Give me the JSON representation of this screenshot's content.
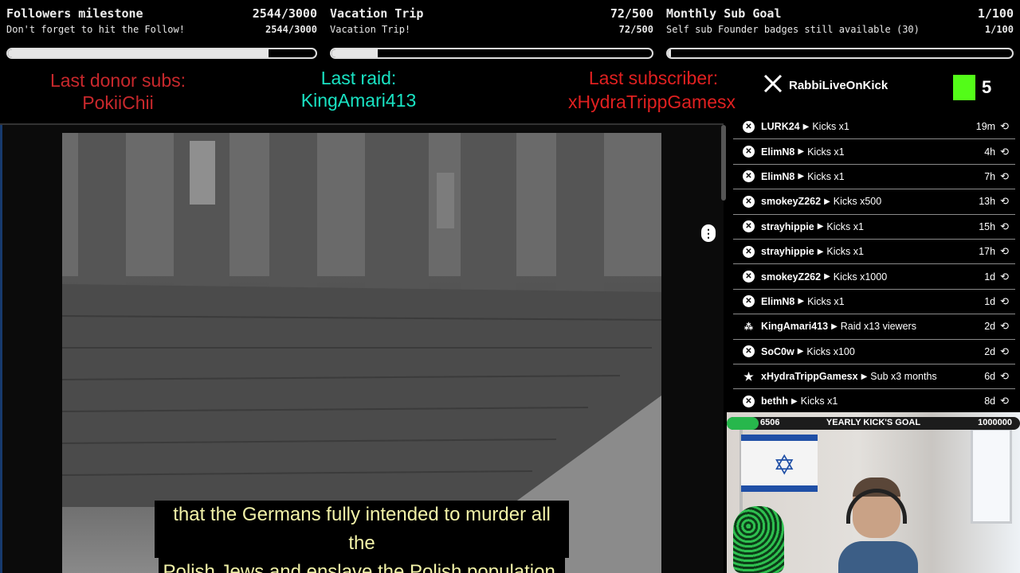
{
  "goals": [
    {
      "title": "Followers milestone",
      "count": "2544/3000",
      "subtitle": "Don't forget to hit the Follow!",
      "subcount": "2544/3000",
      "progress": 0.848
    },
    {
      "title": "Vacation Trip",
      "count": "72/500",
      "subtitle": "Vacation Trip!",
      "subcount": "72/500",
      "progress": 0.144
    },
    {
      "title": "Monthly Sub Goal",
      "count": "1/100",
      "subtitle": "Self sub Founder badges still available (30)",
      "subcount": "1/100",
      "progress": 0.01
    }
  ],
  "banner": {
    "last_donor_label": "Last donor subs:",
    "last_donor_name": "PokiiChii",
    "last_raid_label": "Last raid:",
    "last_raid_name": "KingAmari413",
    "last_sub_label": "Last subscriber:",
    "last_sub_name": "xHydraTrippGamesx",
    "x_handle": "RabbiLiveOnKick",
    "kick_count": "5"
  },
  "video": {
    "caption_line1": "that the Germans fully intended to murder all the",
    "caption_line2": "Polish Jews and enslave the Polish population,"
  },
  "events": [
    {
      "name": "LURK24",
      "action": "Kicks x1",
      "time": "19m",
      "icon": "kick-icon"
    },
    {
      "name": "ElimN8",
      "action": "Kicks x1",
      "time": "4h",
      "icon": "kick-icon"
    },
    {
      "name": "ElimN8",
      "action": "Kicks x1",
      "time": "7h",
      "icon": "kick-icon"
    },
    {
      "name": "smokeyZ262",
      "action": "Kicks x500",
      "time": "13h",
      "icon": "kick-icon"
    },
    {
      "name": "strayhippie",
      "action": "Kicks x1",
      "time": "15h",
      "icon": "kick-icon"
    },
    {
      "name": "strayhippie",
      "action": "Kicks x1",
      "time": "17h",
      "icon": "kick-icon"
    },
    {
      "name": "smokeyZ262",
      "action": "Kicks x1000",
      "time": "1d",
      "icon": "kick-icon"
    },
    {
      "name": "ElimN8",
      "action": "Kicks x1",
      "time": "1d",
      "icon": "kick-icon"
    },
    {
      "name": "KingAmari413",
      "action": "Raid x13 viewers",
      "time": "2d",
      "icon": "raid-icon"
    },
    {
      "name": "SoC0w",
      "action": "Kicks x100",
      "time": "2d",
      "icon": "kick-icon"
    },
    {
      "name": "xHydraTrippGamesx",
      "action": "Sub x3 months",
      "time": "6d",
      "icon": "star-icon"
    },
    {
      "name": "bethh",
      "action": "Kicks x1",
      "time": "8d",
      "icon": "kick-icon"
    }
  ],
  "yearly_goal": {
    "current": "6506",
    "title": "YEARLY KICK'S GOAL",
    "max": "1000000",
    "progress": 0.0065
  },
  "colors": {
    "donor": "#c8282c",
    "raid": "#19e3c3",
    "subscriber": "#e02020",
    "kick_green": "#53fc18",
    "goal_green": "#27b74c"
  }
}
